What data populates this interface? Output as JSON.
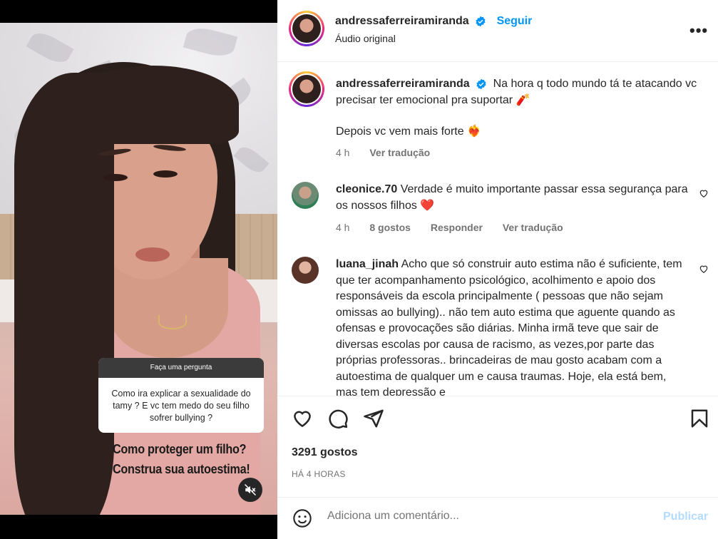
{
  "media": {
    "question_title": "Faça uma pergunta",
    "question_text": "Como ira explicar a sexualidade do tamy ? E vc tem medo do seu filho sofrer bullying ?",
    "overlay_line1": "Como proteger um filho?",
    "overlay_line2": "Construa sua autoestima!",
    "mute_icon": "speaker-muted-icon"
  },
  "header": {
    "username": "andressaferreiramiranda",
    "follow_label": "Seguir",
    "subtitle": "Áudio original",
    "more_label": "•••"
  },
  "caption": {
    "username": "andressaferreiramiranda",
    "text": "Na hora q todo mundo tá te atacando vc precisar ter emocional pra suportar",
    "emoji1": "🧨",
    "text2": "Depois vc vem mais forte",
    "emoji2": "❤️‍🔥",
    "time": "4 h",
    "translate": "Ver tradução"
  },
  "comments": [
    {
      "username": "cleonice.70",
      "text": "Verdade é muito importante passar essa segurança para os nossos filhos",
      "emoji": "❤️",
      "time": "4 h",
      "likes": "8 gostos",
      "reply": "Responder",
      "translate": "Ver tradução"
    },
    {
      "username": "luana_jinah",
      "text": "Acho que só construir auto estima não é suficiente, tem que ter acompanhamento psicológico, acolhimento e apoio dos responsáveis da escola principalmente ( pessoas que não sejam omissas ao bullying).. não tem auto estima que aguente quando as ofensas e provocações são diárias. Minha irmã teve que sair de diversas escolas por causa de racismo, as vezes,por parte das próprias professoras.. brincadeiras de mau gosto acabam com a autoestima de qualquer um e causa traumas. Hoje, ela está bem, mas tem depressão e"
    }
  ],
  "actions": {
    "likes": "3291 gostos",
    "time_ago": "HÁ 4 HORAS"
  },
  "comment_box": {
    "placeholder": "Adiciona um comentário...",
    "publish_label": "Publicar"
  },
  "colors": {
    "accent": "#0095f6",
    "publish_disabled": "#b3dbff",
    "heart_red": "#ed4956"
  }
}
